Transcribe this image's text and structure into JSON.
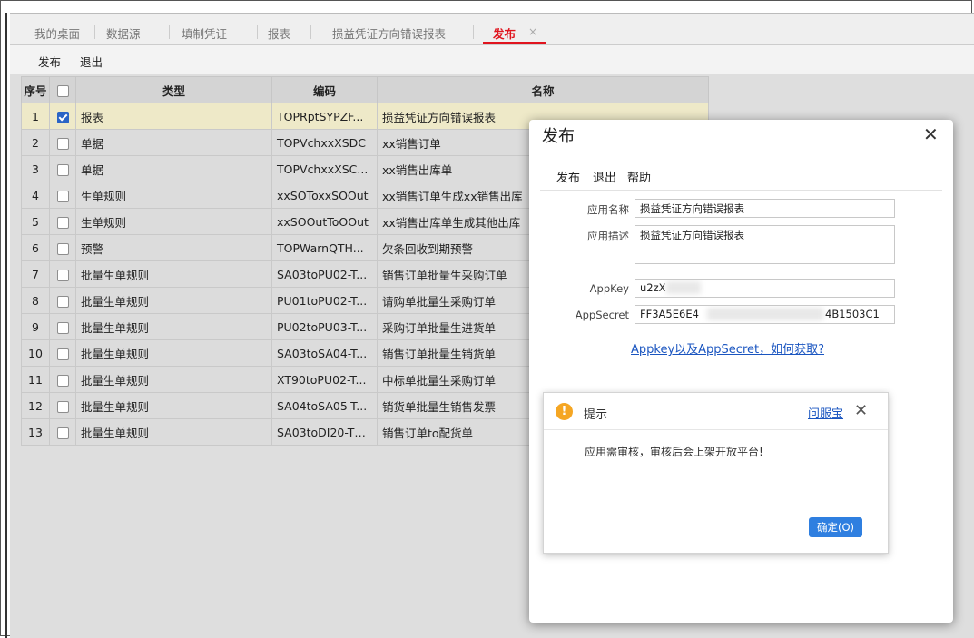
{
  "tabs": [
    {
      "label": "我的桌面",
      "active": false
    },
    {
      "label": "数据源",
      "active": false
    },
    {
      "label": "填制凭证",
      "active": false
    },
    {
      "label": "报表",
      "active": false
    },
    {
      "label": "损益凭证方向错误报表",
      "active": false
    },
    {
      "label": "发布",
      "active": true
    }
  ],
  "tab_close": "×",
  "toolbar": {
    "publish": "发布",
    "exit": "退出"
  },
  "grid": {
    "headers": {
      "no": "序号",
      "type": "类型",
      "code": "编码",
      "name": "名称"
    },
    "rows": [
      {
        "no": "1",
        "checked": true,
        "type": "报表",
        "code": "TOPRptSYPZF...",
        "name": "损益凭证方向错误报表"
      },
      {
        "no": "2",
        "checked": false,
        "type": "单据",
        "code": "TOPVchxxXSDC",
        "name": "xx销售订单"
      },
      {
        "no": "3",
        "checked": false,
        "type": "单据",
        "code": "TOPVchxxXSC...",
        "name": "xx销售出库单"
      },
      {
        "no": "4",
        "checked": false,
        "type": "生单规则",
        "code": "xxSOToxxSOOut",
        "name": "xx销售订单生成xx销售出库"
      },
      {
        "no": "5",
        "checked": false,
        "type": "生单规则",
        "code": "xxSOOutToOOut",
        "name": "xx销售出库单生成其他出库"
      },
      {
        "no": "6",
        "checked": false,
        "type": "预警",
        "code": "TOPWarnQTH...",
        "name": "欠条回收到期预警"
      },
      {
        "no": "7",
        "checked": false,
        "type": "批量生单规则",
        "code": "SA03toPU02-T...",
        "name": "销售订单批量生采购订单"
      },
      {
        "no": "8",
        "checked": false,
        "type": "批量生单规则",
        "code": "PU01toPU02-T...",
        "name": "请购单批量生采购订单"
      },
      {
        "no": "9",
        "checked": false,
        "type": "批量生单规则",
        "code": "PU02toPU03-T...",
        "name": "采购订单批量生进货单"
      },
      {
        "no": "10",
        "checked": false,
        "type": "批量生单规则",
        "code": "SA03toSA04-T...",
        "name": "销售订单批量生销货单"
      },
      {
        "no": "11",
        "checked": false,
        "type": "批量生单规则",
        "code": "XT90toPU02-T...",
        "name": "中标单批量生采购订单"
      },
      {
        "no": "12",
        "checked": false,
        "type": "批量生单规则",
        "code": "SA04toSA05-T...",
        "name": "销货单批量生销售发票"
      },
      {
        "no": "13",
        "checked": false,
        "type": "批量生单规则",
        "code": "SA03toDI20-TO...",
        "name": "销售订单to配货单"
      }
    ]
  },
  "dialog": {
    "title": "发布",
    "close": "✕",
    "toolbar": {
      "publish": "发布",
      "exit": "退出",
      "help": "帮助"
    },
    "fields": {
      "app_name_label": "应用名称",
      "app_name": "损益凭证方向错误报表",
      "app_desc_label": "应用描述",
      "app_desc": "损益凭证方向错误报表",
      "appkey_label": "AppKey",
      "appkey": "u2zX",
      "appsecret_label": "AppSecret",
      "appsecret_head": "FF3A5E6E4",
      "appsecret_tail": "4B1503C1"
    },
    "link": "Appkey以及AppSecret，如何获取?"
  },
  "tip": {
    "icon": "!",
    "title": "提示",
    "help": "问服宝",
    "close": "✕",
    "message": "应用需审核，审核后会上架开放平台!",
    "ok": "确定(O)"
  },
  "colors": {
    "accent": "#e0141e",
    "link": "#1a55c0",
    "button": "#2f7fe0",
    "selected_row": "#eee9c8",
    "warning": "#f5a623"
  }
}
